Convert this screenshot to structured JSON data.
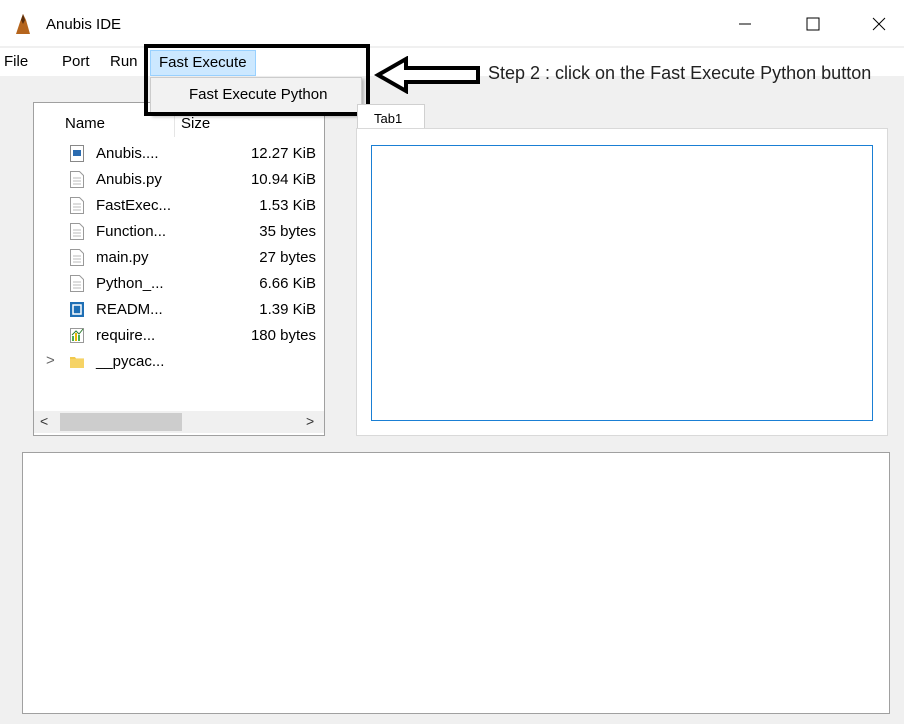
{
  "window": {
    "title": "Anubis IDE",
    "icon": "anubis-logo-icon"
  },
  "menu": {
    "file": "File",
    "port": "Port",
    "run": "Run",
    "fast_execute": "Fast Execute",
    "dropdown_item": "Fast Execute Python"
  },
  "annotation": {
    "text": "Step 2 : click on the Fast Execute Python button"
  },
  "tree": {
    "col_name": "Name",
    "col_size": "Size",
    "rows": [
      {
        "name": "Anubis....",
        "size": "12.27 KiB",
        "icon": "image-file-icon"
      },
      {
        "name": "Anubis.py",
        "size": "10.94 KiB",
        "icon": "text-file-icon"
      },
      {
        "name": "FastExec...",
        "size": "1.53 KiB",
        "icon": "text-file-icon"
      },
      {
        "name": "Function...",
        "size": "35 bytes",
        "icon": "text-file-icon"
      },
      {
        "name": "main.py",
        "size": "27 bytes",
        "icon": "text-file-icon"
      },
      {
        "name": "Python_...",
        "size": "6.66 KiB",
        "icon": "text-file-icon"
      },
      {
        "name": "READM...",
        "size": "1.39 KiB",
        "icon": "markdown-file-icon"
      },
      {
        "name": "require...",
        "size": "180 bytes",
        "icon": "chart-file-icon"
      },
      {
        "name": "__pycac...",
        "size": "",
        "icon": "folder-icon"
      }
    ],
    "scroll_left": "<",
    "scroll_right": ">",
    "expander": ">"
  },
  "tabs": {
    "tab1": "Tab1"
  }
}
